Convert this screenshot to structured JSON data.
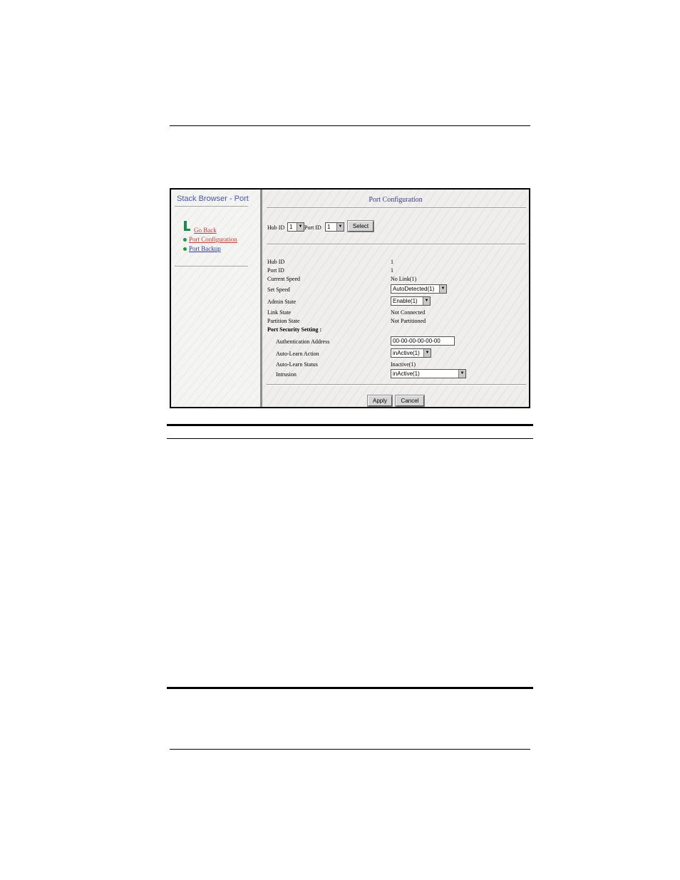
{
  "sidebar": {
    "title": "Stack Browser - Port",
    "items": [
      {
        "label": "Go Back",
        "icon": "back-arrow-icon"
      },
      {
        "label": "Port  Configuration",
        "icon": "green-dot-icon"
      },
      {
        "label": "Port  Backup",
        "icon": "green-dot-icon"
      }
    ]
  },
  "main": {
    "title": "Port Configuration",
    "selector": {
      "hub_label": "Hub ID",
      "hub_value": "1",
      "port_label": "Port ID",
      "port_value": "1",
      "select_button": "Select"
    },
    "fields": {
      "hub_id": {
        "label": "Hub ID",
        "value": "1"
      },
      "port_id": {
        "label": "Port ID",
        "value": "1"
      },
      "current_speed": {
        "label": "Current Speed",
        "value": "No Link(1)"
      },
      "set_speed": {
        "label": "Set Speed",
        "value": "AutoDetected(1)"
      },
      "admin_state": {
        "label": "Admin State",
        "value": "Enable(1)"
      },
      "link_state": {
        "label": "Link State",
        "value": "Not Connected"
      },
      "partition_state": {
        "label": "Partition State",
        "value": "Not Partitioned"
      }
    },
    "security": {
      "heading": "Port Security Setting :",
      "auth_address": {
        "label": "Authentication Address",
        "value": "00-00-00-00-00-00"
      },
      "auto_learn_action": {
        "label": "Auto-Learn Action",
        "value": "inActive(1)"
      },
      "auto_learn_status": {
        "label": "Auto-Learn Status",
        "value": "Inactive(1)"
      },
      "intrusion": {
        "label": "Intrusion",
        "value": "inActive(1)"
      }
    },
    "buttons": {
      "apply": "Apply",
      "cancel": "Cancel"
    }
  }
}
